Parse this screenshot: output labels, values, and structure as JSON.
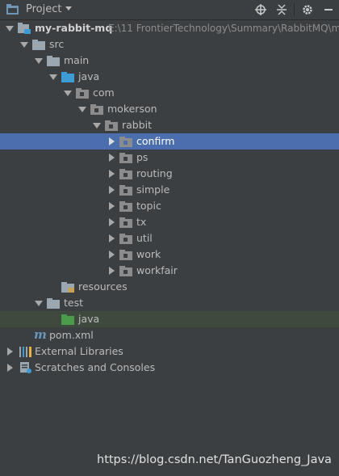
{
  "toolbar": {
    "title": "Project",
    "icons": [
      "folder-icon",
      "chevron-down-icon",
      "locate-icon",
      "collapse-all-icon",
      "gear-icon",
      "hide-panel-icon"
    ]
  },
  "tree": {
    "project_name": "my-rabbit-mq",
    "project_path": "E:\\11 FrontierTechnology\\Summary\\RabbitMQ\\m",
    "src": "src",
    "main": "main",
    "java": "java",
    "com": "com",
    "mokerson": "mokerson",
    "rabbit": "rabbit",
    "packages": [
      "confirm",
      "ps",
      "routing",
      "simple",
      "topic",
      "tx",
      "util",
      "work",
      "workfair"
    ],
    "resources": "resources",
    "test": "test",
    "test_java": "java",
    "pom": "pom.xml",
    "external_libraries": "External Libraries",
    "scratches": "Scratches and Consoles"
  },
  "watermark": "https://blog.csdn.net/TanGuozheng_Java",
  "colors": {
    "background": "#3c3f41",
    "selection": "#4b6eaf",
    "source_folder": "#3d9bd6",
    "test_folder": "#4a9c4a",
    "package_folder": "#8c8c8c"
  }
}
